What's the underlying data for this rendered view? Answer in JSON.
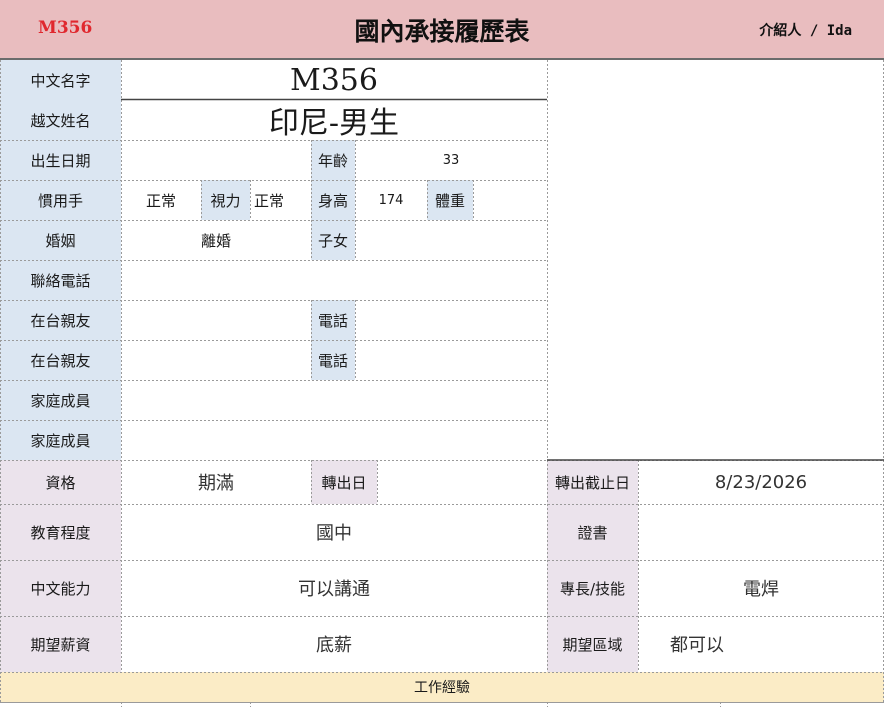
{
  "header": {
    "code": "M356",
    "title": "國內承接履歷表",
    "introducer": "介紹人 / Ida"
  },
  "labels": {
    "chinese_name": "中文名字",
    "vietnamese_name": "越文姓名",
    "birth_date": "出生日期",
    "age": "年齡",
    "handedness": "慣用手",
    "vision": "視力",
    "height": "身高",
    "weight": "體重",
    "marriage": "婚姻",
    "children": "子女",
    "contact_phone": "聯絡電話",
    "relative_in_taiwan_1": "在台親友",
    "phone_1": "電話",
    "relative_in_taiwan_2": "在台親友",
    "phone_2": "電話",
    "family_member_1": "家庭成員",
    "family_member_2": "家庭成員",
    "qualification": "資格",
    "transfer_date": "轉出日",
    "transfer_deadline": "轉出截止日",
    "education": "教育程度",
    "certificate": "證書",
    "chinese_ability": "中文能力",
    "skills": "專長/技能",
    "expected_salary": "期望薪資",
    "expected_region": "期望區域",
    "work_experience": "工作經驗"
  },
  "values": {
    "chinese_name": "M356",
    "vietnamese_name": "印尼-男生",
    "birth_date": "",
    "age": "33",
    "handedness": "正常",
    "vision": "正常",
    "height": "174",
    "weight": "",
    "marriage": "離婚",
    "children": "",
    "contact_phone": "",
    "qualification": "期滿",
    "transfer_date": "",
    "transfer_deadline": "8/23/2026",
    "education": "國中",
    "certificate": "",
    "chinese_ability": "可以講通",
    "skills": "電焊",
    "expected_salary": "底薪",
    "expected_region": "都可以"
  }
}
